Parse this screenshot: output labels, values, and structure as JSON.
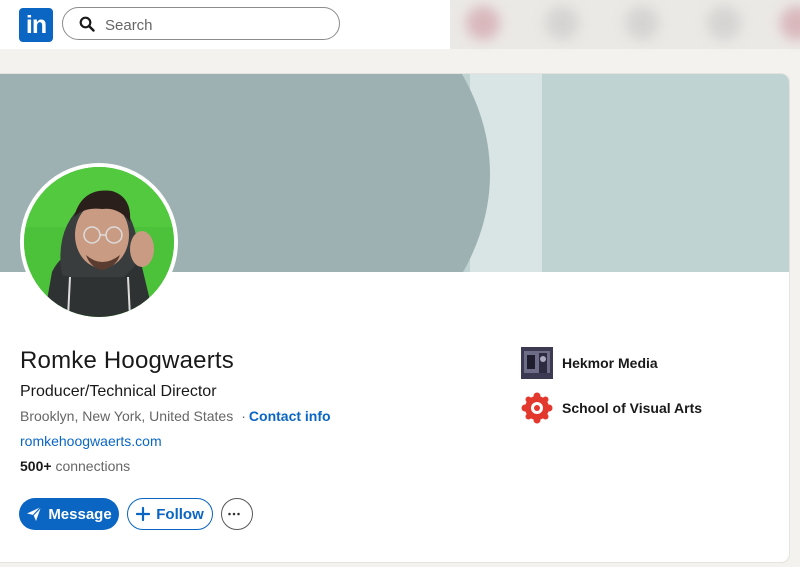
{
  "nav": {
    "logo_text": "in",
    "search_placeholder": "Search"
  },
  "profile": {
    "name": "Romke Hoogwaerts",
    "headline": "Producer/Technical Director",
    "location": "Brooklyn, New York, United States",
    "separator": "·",
    "contact_info": "Contact info",
    "website": "romkehoogwaerts.com",
    "connections_count": "500+",
    "connections_label": "connections"
  },
  "actions": {
    "message": "Message",
    "follow": "Follow"
  },
  "experience": [
    {
      "name": "Hekmor Media",
      "icon": "company-logo-icon"
    },
    {
      "name": "School of Visual Arts",
      "icon": "school-logo-icon"
    }
  ],
  "colors": {
    "brand": "#0a66c2",
    "avatar_bg": "#4cc23a",
    "banner_dark": "#9eb1b2",
    "banner_light": "#bfd3d3"
  }
}
